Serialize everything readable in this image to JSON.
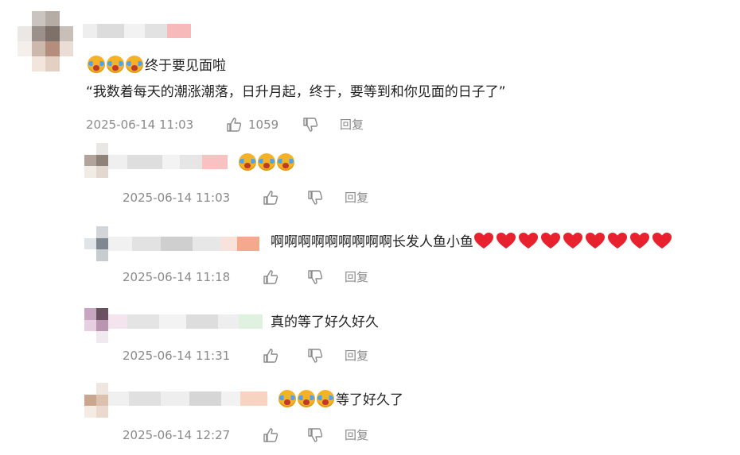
{
  "colors": {
    "meta": "#8a8a8a",
    "text": "#222222",
    "emoji_yellow": "#f5b227",
    "heart_red": "#e8212e"
  },
  "main_comment": {
    "line1": "终于要见面啦",
    "line2": "“我数着每天的潮涨潮落，日升月起，终于，要等到和你见面的日子了”",
    "time": "2025-06-14 11:03",
    "likes": "1059",
    "reply": "回复",
    "emoji_count": 3
  },
  "replies": [
    {
      "text": "",
      "emoji_before": 3,
      "hearts_after": 0,
      "time": "2025-06-14 11:03",
      "reply": "回复"
    },
    {
      "text": "啊啊啊啊啊啊啊啊啊长发人鱼小鱼",
      "emoji_before": 0,
      "hearts_after": 9,
      "time": "2025-06-14 11:18",
      "reply": "回复"
    },
    {
      "text": "真的等了好久好久",
      "emoji_before": 0,
      "hearts_after": 0,
      "time": "2025-06-14 11:31",
      "reply": "回复"
    },
    {
      "text": "等了好久了",
      "emoji_before": 3,
      "hearts_after": 0,
      "time": "2025-06-14 12:27",
      "reply": "回复"
    }
  ],
  "icons": {
    "like": "thumbs-up-icon",
    "dislike": "thumbs-down-icon",
    "cry_emoji": "loudly-crying-emoji-icon",
    "heart": "red-heart-icon"
  }
}
